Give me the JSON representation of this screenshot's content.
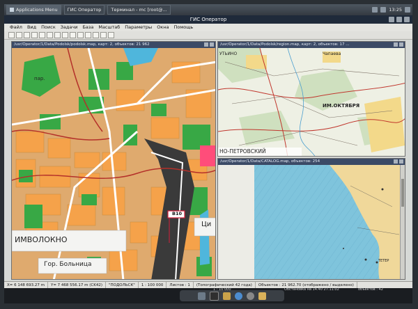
{
  "os_taskbar": {
    "items": [
      "Applications Menu",
      "ГИС Оператор",
      "Терминал - mc [root@..."
    ],
    "clock": "13:25"
  },
  "window": {
    "title": "ГИС Оператор"
  },
  "menu": {
    "items": [
      "Файл",
      "Вид",
      "Поиск",
      "Задачи",
      "База",
      "Масштаб",
      "Параметры",
      "Окна",
      "Помощь"
    ]
  },
  "panes": {
    "left": {
      "title": "/usr/Operator/1/Data/Podolsk/podolsk.map, карт: 2, объектов: 21 962",
      "labels": {
        "park": "пар.",
        "factory": "ИМВОЛОКНО",
        "hospital": "Гор. Больница",
        "marker": "В10",
        "city_fragment": "Ци"
      }
    },
    "top_right": {
      "title": "/usr/Operator/1/Data/Podolsk/region.map, карт: 2, объектов: 17 ...",
      "labels": {
        "place1": "УТЬИНО",
        "place2": "Чапаева",
        "place3": "ИМ.ОКТЯБРЯ",
        "place4": "НО-ПЕТРОВСКИЙ"
      }
    },
    "bottom_right": {
      "title": "/usr/Operator/1/Data/CATALOG.map, объектов: 254",
      "labels": {
        "point": "ТЕТЕР"
      }
    }
  },
  "status_bar": {
    "coord_x": "Х= 6 148 693.27 m",
    "coord_y": "Y= 7 468 556.17 m (CK42)",
    "layer": "\"ПОДОЛЬСК\"",
    "scale": "1 : 100 000",
    "sheets": "Листов : 1",
    "map_type": "(Топографический 42 года)",
    "objects": "Объектов : 21 962.70 (отображено / выделено)",
    "scale_small": "1 : 10 000",
    "situation": "Обстановка на 14.40 27.11.02",
    "situation_objects": "объектов : 42"
  },
  "colors": {
    "map_bg": "#f5a24a",
    "green": "#3cae48",
    "water": "#4fb6dc",
    "sea": "#7fc4dc",
    "road": "#ffffff",
    "red_road": "#b4302a",
    "title_bar": "#1f2a3a"
  }
}
